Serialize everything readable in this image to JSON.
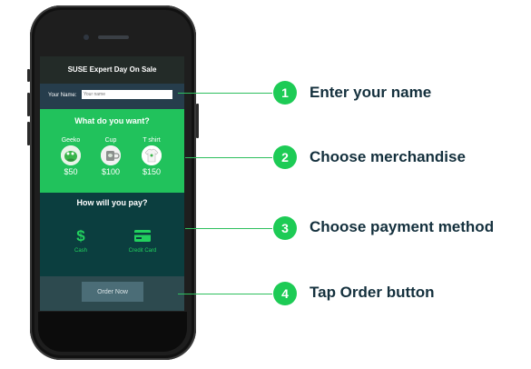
{
  "app": {
    "title": "SUSE Expert Day On Sale",
    "name_label": "Your Name:",
    "name_placeholder": "Your name"
  },
  "merch": {
    "heading": "What do you want?",
    "items": [
      {
        "label": "Geeko",
        "price": "$50",
        "icon": "geeko-plush-icon"
      },
      {
        "label": "Cup",
        "price": "$100",
        "icon": "cup-icon"
      },
      {
        "label": "T shirt",
        "price": "$150",
        "icon": "tshirt-icon"
      }
    ]
  },
  "payment": {
    "heading": "How will you pay?",
    "options": [
      {
        "label": "Cash",
        "icon": "dollar-icon"
      },
      {
        "label": "Credit Card",
        "icon": "credit-card-icon"
      }
    ]
  },
  "order": {
    "button_label": "Order Now"
  },
  "callouts": [
    {
      "number": "1",
      "text": "Enter your name"
    },
    {
      "number": "2",
      "text": "Choose merchandise"
    },
    {
      "number": "3",
      "text": "Choose payment method"
    },
    {
      "number": "4",
      "text": "Tap Order button"
    }
  ],
  "colors": {
    "accent": "#21c25c",
    "payment_bg": "#0b3e3f",
    "callout_text": "#14303d"
  }
}
